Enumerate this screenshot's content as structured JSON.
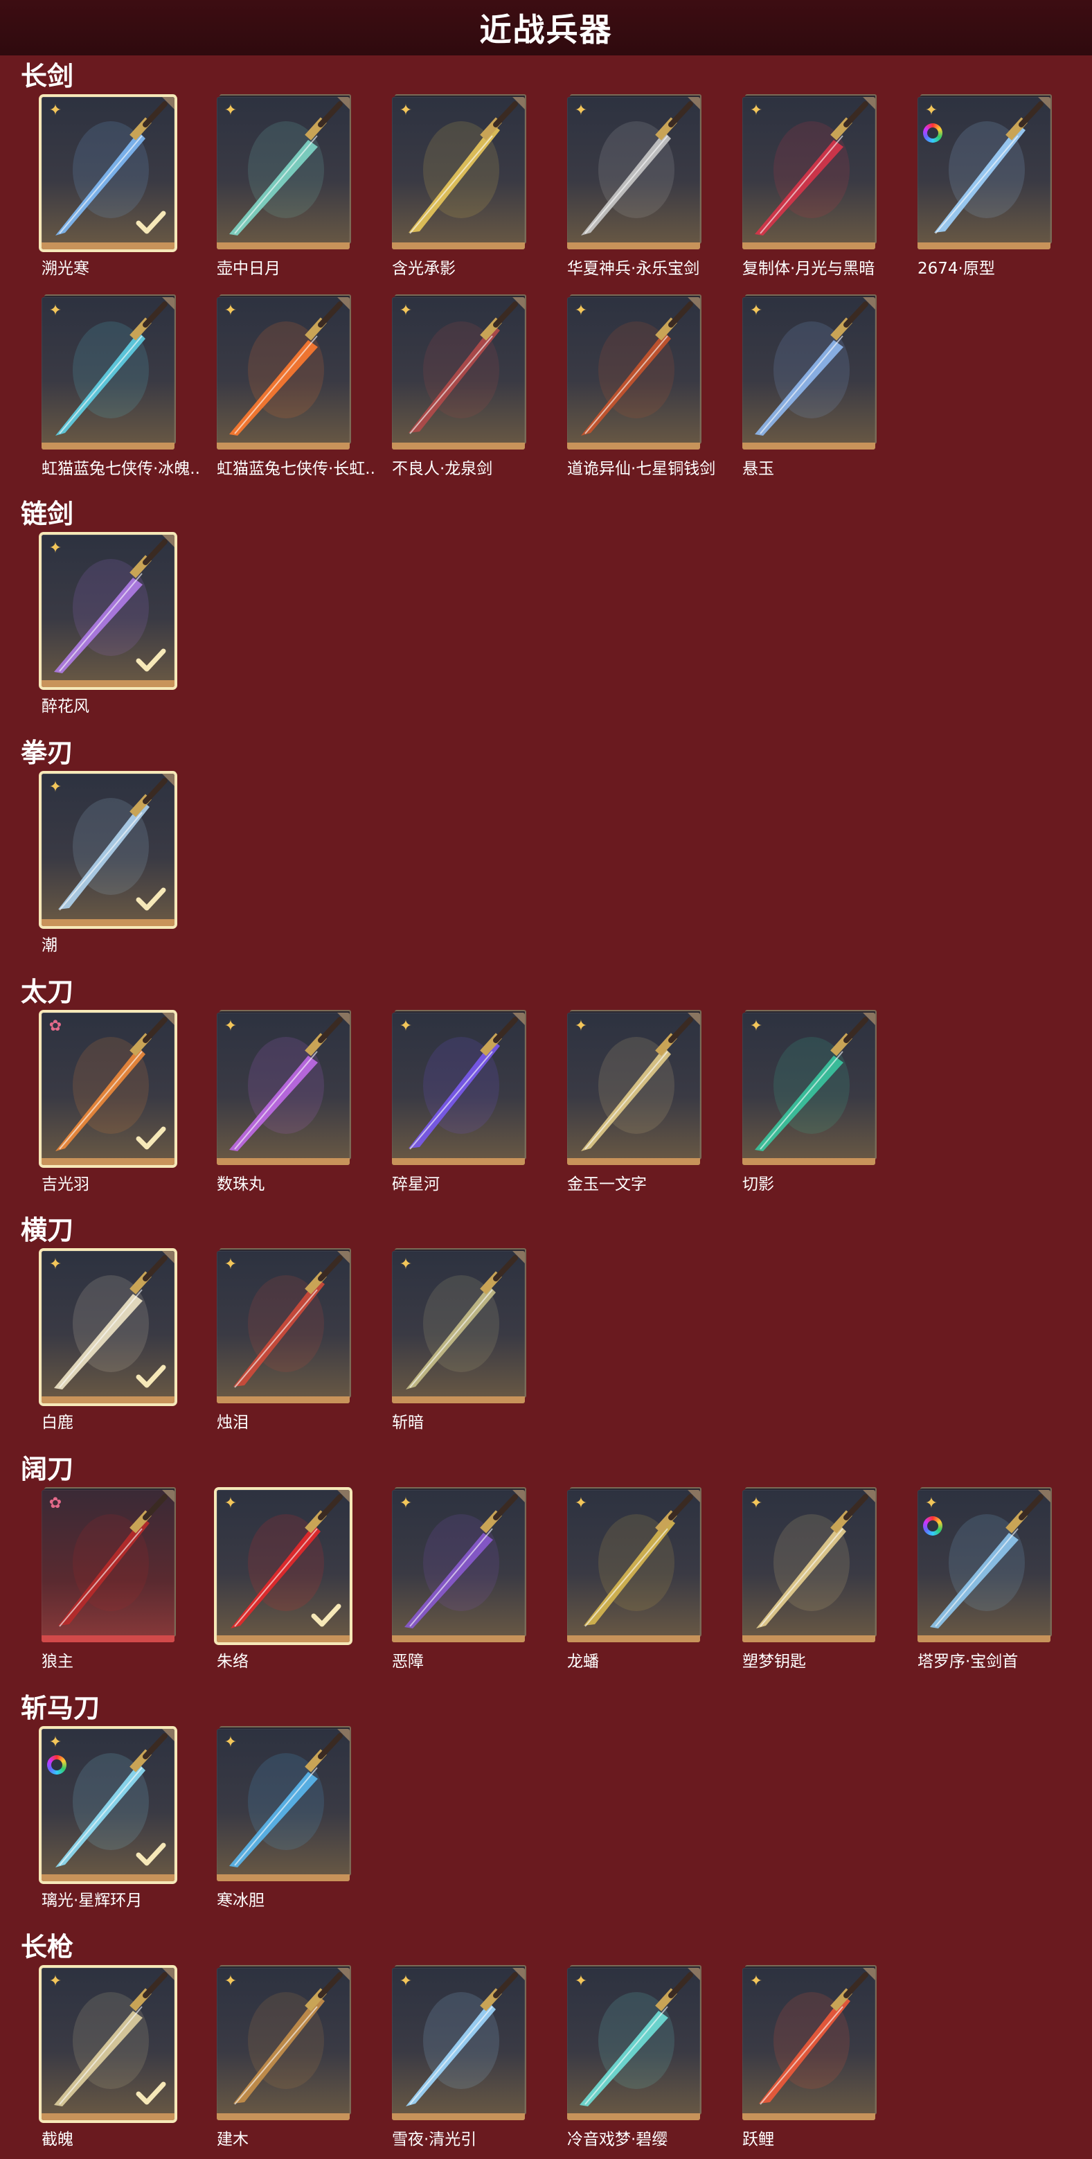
{
  "header": {
    "title": "近战兵器"
  },
  "sections": [
    {
      "title": "长剑",
      "items": [
        {
          "name": "溯光寒",
          "selected": true,
          "tier": "gold",
          "accent": "#7fbaf7"
        },
        {
          "name": "壶中日月",
          "tier": "gold",
          "accent": "#7fd7c8"
        },
        {
          "name": "含光承影",
          "tier": "gold",
          "accent": "#e9c85a"
        },
        {
          "name": "华夏神兵·永乐宝剑",
          "tier": "gold",
          "accent": "#c9c9c9"
        },
        {
          "name": "复制体·月光与黑暗",
          "tier": "gold",
          "accent": "#d8344a"
        },
        {
          "name": "2674·原型",
          "tier": "gold",
          "prism": true,
          "accent": "#9fd3ff"
        },
        {
          "name": "虹猫蓝兔七侠传·冰魄..",
          "tier": "gold",
          "accent": "#5fd0e6"
        },
        {
          "name": "虹猫蓝兔七侠传·长虹..",
          "tier": "gold",
          "accent": "#ff7a2f"
        },
        {
          "name": "不良人·龙泉剑",
          "tier": "gold",
          "accent": "#b34a4a"
        },
        {
          "name": "道诡异仙·七星铜钱剑",
          "tier": "gold",
          "accent": "#c9542c"
        },
        {
          "name": "悬玉",
          "tier": "gold",
          "accent": "#8fb8f0"
        }
      ]
    },
    {
      "title": "链剑",
      "items": [
        {
          "name": "醉花风",
          "selected": true,
          "tier": "gold",
          "accent": "#b07ce8"
        }
      ]
    },
    {
      "title": "拳刃",
      "items": [
        {
          "name": "潮",
          "selected": true,
          "tier": "gold",
          "accent": "#b0d4f0"
        }
      ]
    },
    {
      "title": "太刀",
      "items": [
        {
          "name": "吉光羽",
          "selected": true,
          "tier": "pink",
          "accent": "#f08a3a"
        },
        {
          "name": "数珠丸",
          "tier": "gold",
          "accent": "#c06ae8"
        },
        {
          "name": "碎星河",
          "tier": "gold",
          "accent": "#7a5af0"
        },
        {
          "name": "金玉一文字",
          "tier": "gold",
          "accent": "#e2cc8a"
        },
        {
          "name": "切影",
          "tier": "gold",
          "accent": "#3ac6a0"
        }
      ]
    },
    {
      "title": "横刀",
      "items": [
        {
          "name": "白鹿",
          "selected": true,
          "tier": "gold",
          "accent": "#efe6c8"
        },
        {
          "name": "烛泪",
          "tier": "gold",
          "accent": "#d04a3a"
        },
        {
          "name": "斩暗",
          "tier": "gold",
          "accent": "#c8c08a"
        }
      ]
    },
    {
      "title": "阔刀",
      "items": [
        {
          "name": "狼主",
          "tier": "pink",
          "red": true,
          "accent": "#b82a2a"
        },
        {
          "name": "朱络",
          "selected": true,
          "tier": "gold",
          "accent": "#e8282a"
        },
        {
          "name": "恶障",
          "tier": "gold",
          "accent": "#8a5ad0"
        },
        {
          "name": "龙蟠",
          "tier": "gold",
          "accent": "#d8b850"
        },
        {
          "name": "塑梦钥匙",
          "tier": "gold",
          "accent": "#e8d090"
        },
        {
          "name": "塔罗序·宝剑首",
          "tier": "gold",
          "prism": true,
          "accent": "#8fc8f0"
        }
      ]
    },
    {
      "title": "斩马刀",
      "items": [
        {
          "name": "璃光·星辉环月",
          "selected": true,
          "tier": "gold",
          "prism": true,
          "accent": "#8fe0f8"
        },
        {
          "name": "寒冰胆",
          "tier": "gold",
          "accent": "#5ab8f0"
        }
      ]
    },
    {
      "title": "长枪",
      "items": [
        {
          "name": "截魄",
          "selected": true,
          "tier": "gold",
          "accent": "#e0d0a0"
        },
        {
          "name": "建木",
          "tier": "gold",
          "accent": "#c8904a"
        },
        {
          "name": "雪夜·清光引",
          "tier": "gold",
          "accent": "#9fd8ff"
        },
        {
          "name": "冷音戏梦·碧缨",
          "tier": "gold",
          "accent": "#6fe0d8"
        },
        {
          "name": "跃鲤",
          "tier": "gold",
          "accent": "#f05a3a"
        }
      ]
    }
  ],
  "colors": {
    "background": "#6a1a1f",
    "header": "#2f0a0e",
    "card_bottom_gold": "#c8935a",
    "card_bottom_red": "#d24a4a",
    "selected_border": "#f6e8b8",
    "checkmark": "#f6e8b8"
  },
  "icons": {
    "rank": "four-point-star-icon",
    "rank_pink": "flower-icon",
    "prism": "rainbow-ring-icon",
    "selected": "checkmark-icon"
  }
}
